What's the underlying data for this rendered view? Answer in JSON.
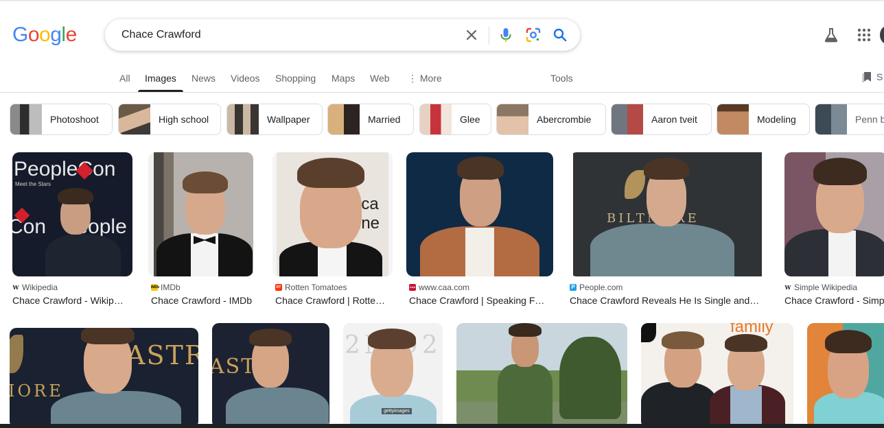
{
  "logo": {
    "letters": [
      "G",
      "o",
      "o",
      "g",
      "l",
      "e"
    ],
    "colors": [
      "#4285F4",
      "#EA4335",
      "#FBBC05",
      "#4285F4",
      "#34A853",
      "#EA4335"
    ]
  },
  "search": {
    "query": "Chace Crawford"
  },
  "header_icons": [
    "clear-icon",
    "mic-icon",
    "lens-icon",
    "search-icon",
    "labs-icon",
    "apps-icon"
  ],
  "tabs": [
    "All",
    "Images",
    "News",
    "Videos",
    "Shopping",
    "Maps",
    "Web",
    "More",
    "Tools"
  ],
  "active_tab": "Images",
  "saved_label": "S",
  "chips": [
    "Photoshoot",
    "High school",
    "Wallpaper",
    "Married",
    "Glee",
    "Abercrombie",
    "Aaron tveit",
    "Modeling",
    "Penn b"
  ],
  "results_row1": [
    {
      "source": "Wikipedia",
      "title": "Chace Crawford - Wikip…",
      "favicon": "W"
    },
    {
      "source": "IMDb",
      "title": "Chace Crawford - IMDb",
      "favicon": "IMDb"
    },
    {
      "source": "Rotten Tomatoes",
      "title": "Chace Crawford | Rotte…",
      "favicon": "RT"
    },
    {
      "source": "www.caa.com",
      "title": "Chace Crawford | Speaking F…",
      "favicon": "CAA"
    },
    {
      "source": "People.com",
      "title": "Chace Crawford Reveals He Is Single and…",
      "favicon": "P"
    },
    {
      "source": "Simple Wikipedia",
      "title": "Chace Crawford - Simp",
      "favicon": "W"
    }
  ],
  "watermarks": {
    "peoplecon_top": "PeopleCon",
    "peoplecon_sub": "Meet the Stars",
    "peoplecon_bottom": "Con eople",
    "rt_side": "ica ine",
    "biltmore": "BILTMORE",
    "astra": "ASTRA",
    "astra_left": "IORE",
    "getty": "gettyimages",
    "family": "family"
  },
  "colors": {
    "accent": "#1a73e8",
    "text_secondary": "#5f6368",
    "border": "#dadce0"
  }
}
